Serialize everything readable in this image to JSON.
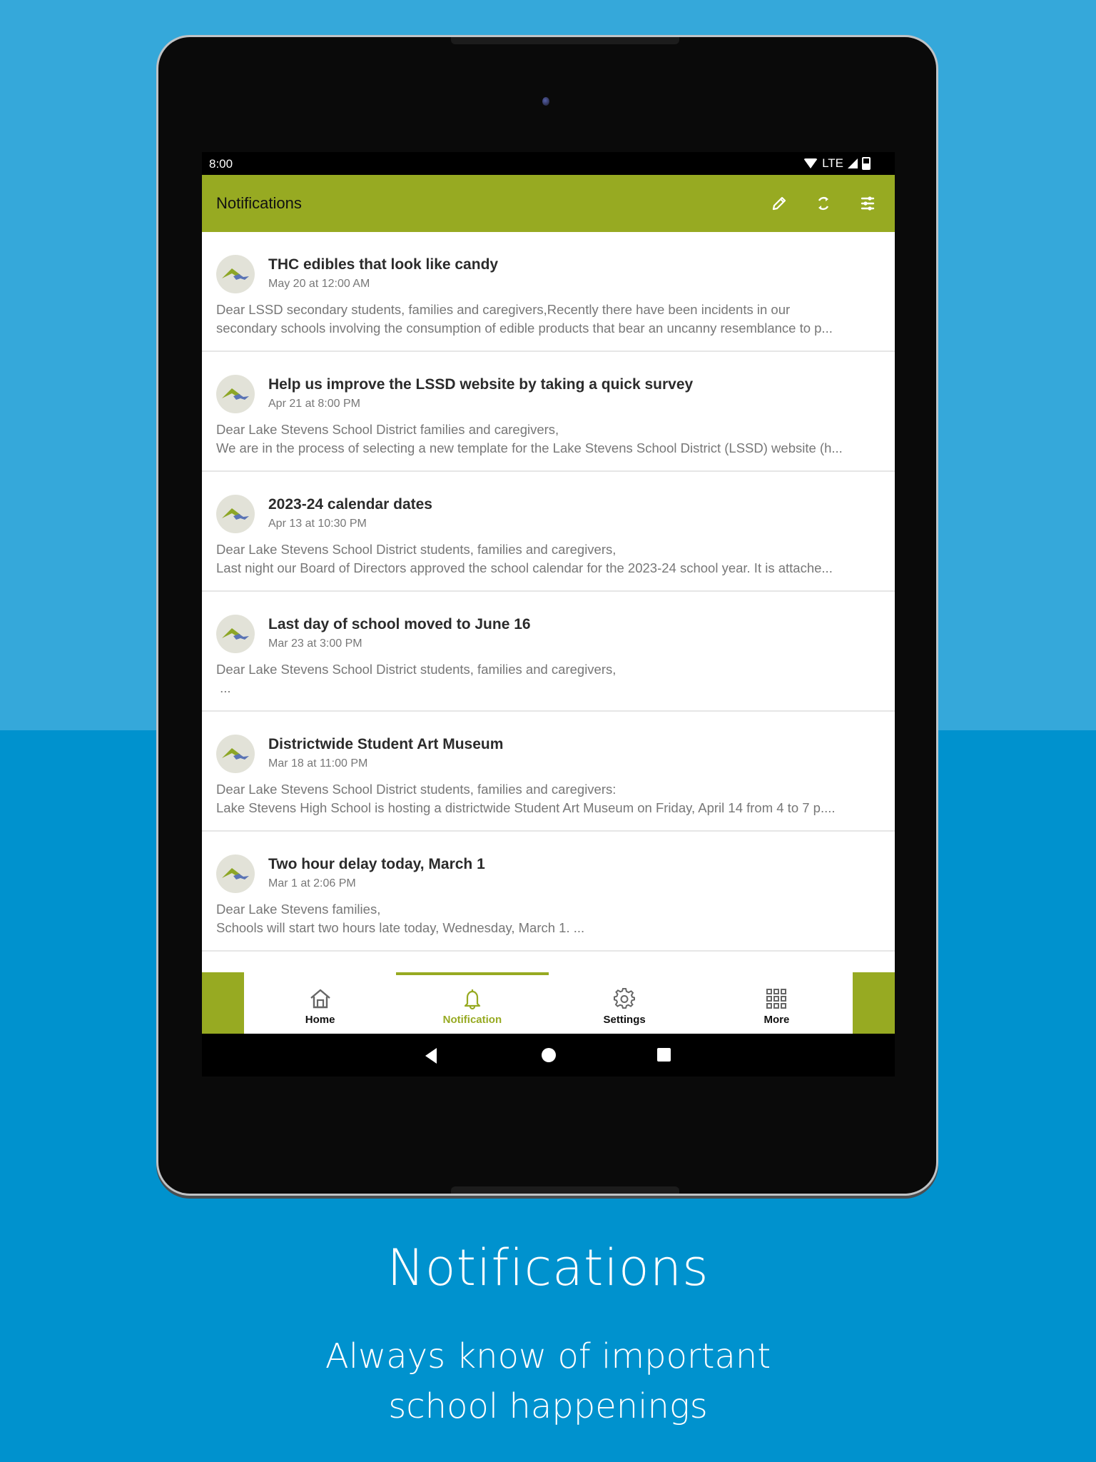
{
  "status_bar": {
    "time": "8:00",
    "network": "LTE"
  },
  "app_bar": {
    "title": "Notifications",
    "actions": [
      {
        "icon": "pencil-icon",
        "label": "Edit"
      },
      {
        "icon": "refresh-icon",
        "label": "Refresh"
      },
      {
        "icon": "filter-sliders-icon",
        "label": "Filter"
      }
    ]
  },
  "notifications": [
    {
      "title": "THC edibles that look like candy",
      "date": "May 20 at 12:00 AM",
      "body_line1": "Dear LSSD secondary students, families and caregivers,Recently there have been incidents in our",
      "body_line2": "secondary schools involving the consumption of edible products that bear an uncanny resemblance to p..."
    },
    {
      "title": "Help us improve the LSSD website by taking a quick survey",
      "date": "Apr 21 at 8:00 PM",
      "body_line1": "Dear Lake Stevens School District families and caregivers,",
      "body_line2": "We are in the process of selecting a new template for the Lake Stevens School District (LSSD) website (h..."
    },
    {
      "title": "2023-24 calendar dates",
      "date": "Apr 13 at 10:30 PM",
      "body_line1": "Dear Lake Stevens School District students, families and caregivers,",
      "body_line2": "Last night our Board of Directors approved the school calendar for the 2023-24 school year. It is attache..."
    },
    {
      "title": "Last day of school moved to June 16",
      "date": "Mar 23 at 3:00 PM",
      "body_line1": "Dear Lake Stevens School District students, families and caregivers,",
      "body_line2": " ..."
    },
    {
      "title": "Districtwide Student Art Museum",
      "date": "Mar 18 at 11:00 PM",
      "body_line1": "Dear Lake Stevens School District students, families and caregivers:",
      "body_line2": "Lake Stevens High School is hosting a districtwide Student Art Museum on Friday, April 14 from 4 to 7 p...."
    },
    {
      "title": "Two hour delay today, March 1",
      "date": "Mar 1 at 2:06 PM",
      "body_line1": "Dear Lake Stevens families,",
      "body_line2": "Schools will start two hours late today, Wednesday, March 1. ..."
    }
  ],
  "bottom_nav": {
    "active": "Notification",
    "tabs": [
      {
        "label": "Home",
        "icon": "home-icon"
      },
      {
        "label": "Notification",
        "icon": "bell-icon"
      },
      {
        "label": "Settings",
        "icon": "gear-icon"
      },
      {
        "label": "More",
        "icon": "grid-icon"
      }
    ]
  },
  "colors": {
    "brand_green": "#97AA22",
    "bg_top": "#35A8DA",
    "bg_bottom": "#0092CE"
  },
  "promo": {
    "title": "Notifications",
    "subtitle_line1": "Always know of important",
    "subtitle_line2": "school happenings"
  }
}
